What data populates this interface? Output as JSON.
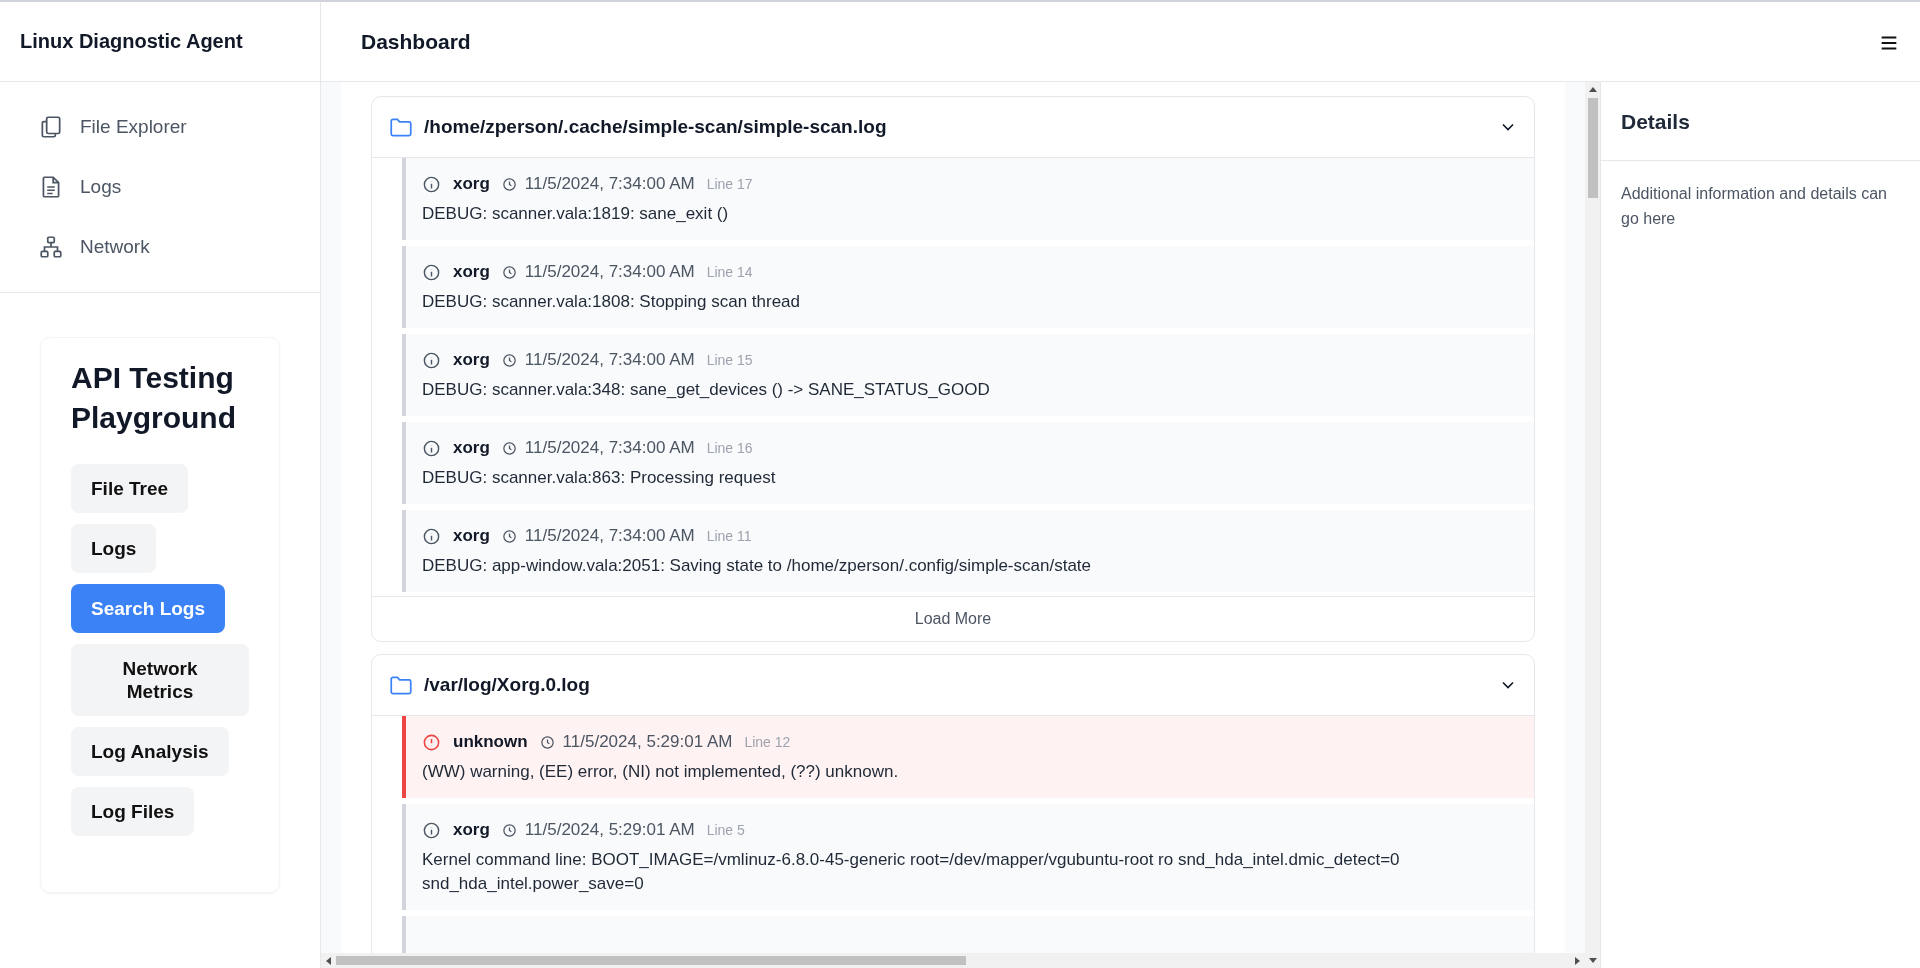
{
  "sidebar": {
    "title": "Linux Diagnostic Agent",
    "nav": [
      {
        "label": "File Explorer",
        "kind": "files"
      },
      {
        "label": "Logs",
        "kind": "document"
      },
      {
        "label": "Network",
        "kind": "network"
      }
    ]
  },
  "playground": {
    "title": "API Testing Playground",
    "buttons": [
      {
        "label": "File Tree",
        "selected": false
      },
      {
        "label": "Logs",
        "selected": false
      },
      {
        "label": "Search Logs",
        "selected": true
      },
      {
        "label": "Network Metrics",
        "selected": false
      },
      {
        "label": "Log Analysis",
        "selected": false
      },
      {
        "label": "Log Files",
        "selected": false
      }
    ]
  },
  "header": {
    "title": "Dashboard"
  },
  "log_files": [
    {
      "path": "/home/zperson/.cache/simple-scan/simple-scan.log",
      "expanded": true,
      "load_more": "Load More",
      "entries": [
        {
          "kind": "info",
          "source": "xorg",
          "time": "11/5/2024, 7:34:00 AM",
          "line": "Line 17",
          "message": "DEBUG: scanner.vala:1819: sane_exit ()"
        },
        {
          "kind": "info",
          "source": "xorg",
          "time": "11/5/2024, 7:34:00 AM",
          "line": "Line 14",
          "message": "DEBUG: scanner.vala:1808: Stopping scan thread"
        },
        {
          "kind": "info",
          "source": "xorg",
          "time": "11/5/2024, 7:34:00 AM",
          "line": "Line 15",
          "message": "DEBUG: scanner.vala:348: sane_get_devices () -> SANE_STATUS_GOOD"
        },
        {
          "kind": "info",
          "source": "xorg",
          "time": "11/5/2024, 7:34:00 AM",
          "line": "Line 16",
          "message": "DEBUG: scanner.vala:863: Processing request"
        },
        {
          "kind": "info",
          "source": "xorg",
          "time": "11/5/2024, 7:34:00 AM",
          "line": "Line 11",
          "message": "DEBUG: app-window.vala:2051: Saving state to /home/zperson/.config/simple-scan/state"
        }
      ]
    },
    {
      "path": "/var/log/Xorg.0.log",
      "expanded": true,
      "entries": [
        {
          "kind": "error",
          "source": "unknown",
          "time": "11/5/2024, 5:29:01 AM",
          "line": "Line 12",
          "message": "(WW) warning, (EE) error, (NI) not implemented, (??) unknown."
        },
        {
          "kind": "info",
          "source": "xorg",
          "time": "11/5/2024, 5:29:01 AM",
          "line": "Line 5",
          "message": "Kernel command line: BOOT_IMAGE=/vmlinuz-6.8.0-45-generic root=/dev/mapper/vgubuntu-root ro snd_hda_intel.dmic_detect=0 snd_hda_intel.power_save=0"
        }
      ]
    }
  ],
  "details": {
    "title": "Details",
    "text": "Additional information and details can go here"
  }
}
